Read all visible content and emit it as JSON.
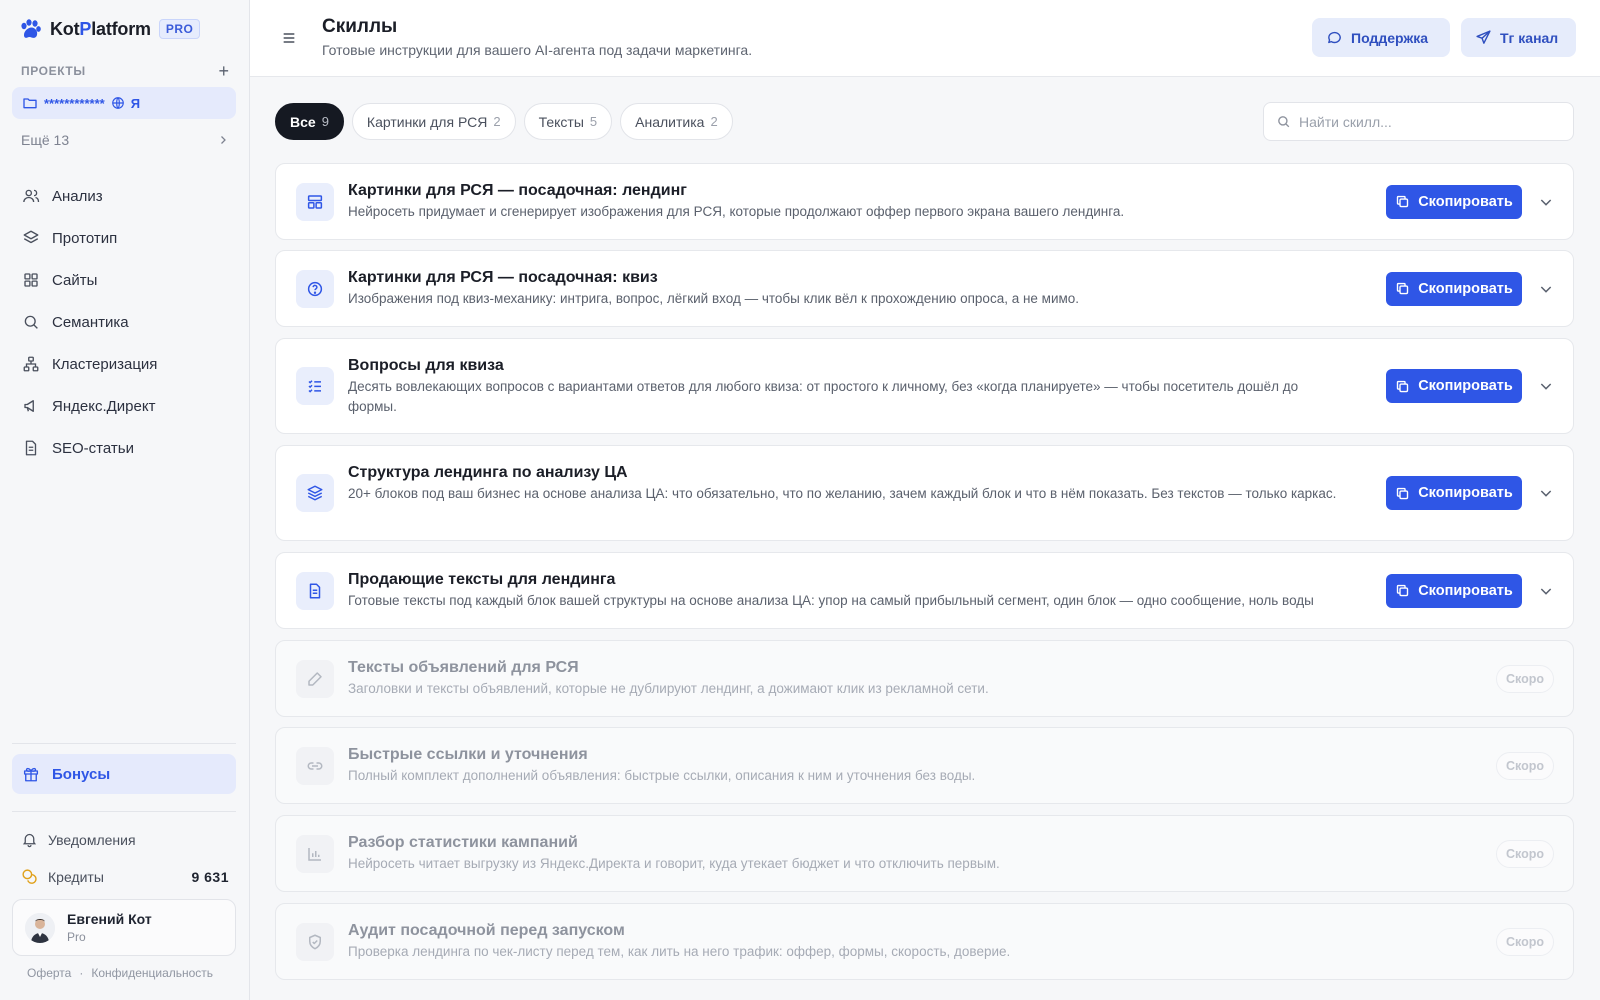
{
  "brand": {
    "name_part1": "Kot",
    "name_accent": "P",
    "name_part2": "latform",
    "badge": "PRO"
  },
  "sidebar": {
    "projects_title": "ПРОЕКТЫ",
    "project": {
      "name": "************",
      "suffix": "Я"
    },
    "more_label": "Ещё 13",
    "nav": [
      "Анализ",
      "Прототип",
      "Сайты",
      "Семантика",
      "Кластеризация",
      "Яндекс.Директ",
      "SEO-статьи"
    ],
    "bonus_label": "Бонусы",
    "notifications_label": "Уведомления",
    "credits_label": "Кредиты",
    "credits_value": "9 631",
    "user": {
      "name": "Евгений Кот",
      "plan": "Pro"
    },
    "legal": {
      "offer": "Оферта",
      "separator": "·",
      "privacy": "Конфиденциальность"
    }
  },
  "header": {
    "title": "Скиллы",
    "subtitle": "Готовые инструкции для вашего AI-агента под задачи маркетинга.",
    "support_label": "Поддержка",
    "tg_label": "Tг канал"
  },
  "filters": [
    {
      "label": "Все",
      "count": "9"
    },
    {
      "label": "Картинки для РСЯ",
      "count": "2"
    },
    {
      "label": "Тексты",
      "count": "5"
    },
    {
      "label": "Аналитика",
      "count": "2"
    }
  ],
  "search": {
    "placeholder": "Найти скилл..."
  },
  "copy_label": "Скопировать",
  "soon_label": "Скоро",
  "skills": [
    {
      "title": "Картинки для РСЯ — посадочная: лендинг",
      "description": "Нейросеть придумает и сгенерирует изображения для РСЯ, которые продолжают оффер первого экрана вашего лендинга.",
      "icon": "layout-icon"
    },
    {
      "title": "Картинки для РСЯ — посадочная: квиз",
      "description": "Изображения под квиз-механику: интрига, вопрос, лёгкий вход — чтобы клик вёл к прохождению опроса, а не мимо.",
      "icon": "question-circle-icon"
    },
    {
      "title": "Вопросы для квиза",
      "description": "Десять вовлекающих вопросов с вариантами ответов для любого квиза: от простого к личному, без «когда планируете» — чтобы посетитель дошёл до формы.",
      "icon": "checklist-icon"
    },
    {
      "title": "Структура лендинга по анализу ЦА",
      "description": "20+ блоков под ваш бизнес на основе анализа ЦА: что обязательно, что по желанию, зачем каждый блок и что в нём показать. Без текстов — только каркас.",
      "icon": "layers-icon"
    },
    {
      "title": "Продающие тексты для лендинга",
      "description": "Готовые тексты под каждый блок вашей структуры на основе анализа ЦА: упор на самый прибыльный сегмент, один блок — одно сообщение, ноль воды",
      "icon": "document-icon"
    },
    {
      "title": "Тексты объявлений для РСЯ",
      "description": "Заголовки и тексты объявлений, которые не дублируют лендинг, а дожимают клик из рекламной сети.",
      "icon": "pencil-icon"
    },
    {
      "title": "Быстрые ссылки и уточнения",
      "description": "Полный комплект дополнений объявления: быстрые ссылки, описания к ним и уточнения без воды.",
      "icon": "link-icon"
    },
    {
      "title": "Разбор статистики кампаний",
      "description": "Нейросеть читает выгрузку из Яндекс.Директа и говорит, куда утекает бюджет и что отключить первым.",
      "icon": "bar-chart-icon"
    },
    {
      "title": "Аудит посадочной перед запуском",
      "description": "Проверка лендинга по чек-листу перед тем, как лить на него трафик: оффер, формы, скорость, доверие.",
      "icon": "shield-check-icon"
    }
  ],
  "colors": {
    "accent": "#2f56e6",
    "accent_soft": "#e5eafc",
    "dark_chip": "#151922"
  }
}
